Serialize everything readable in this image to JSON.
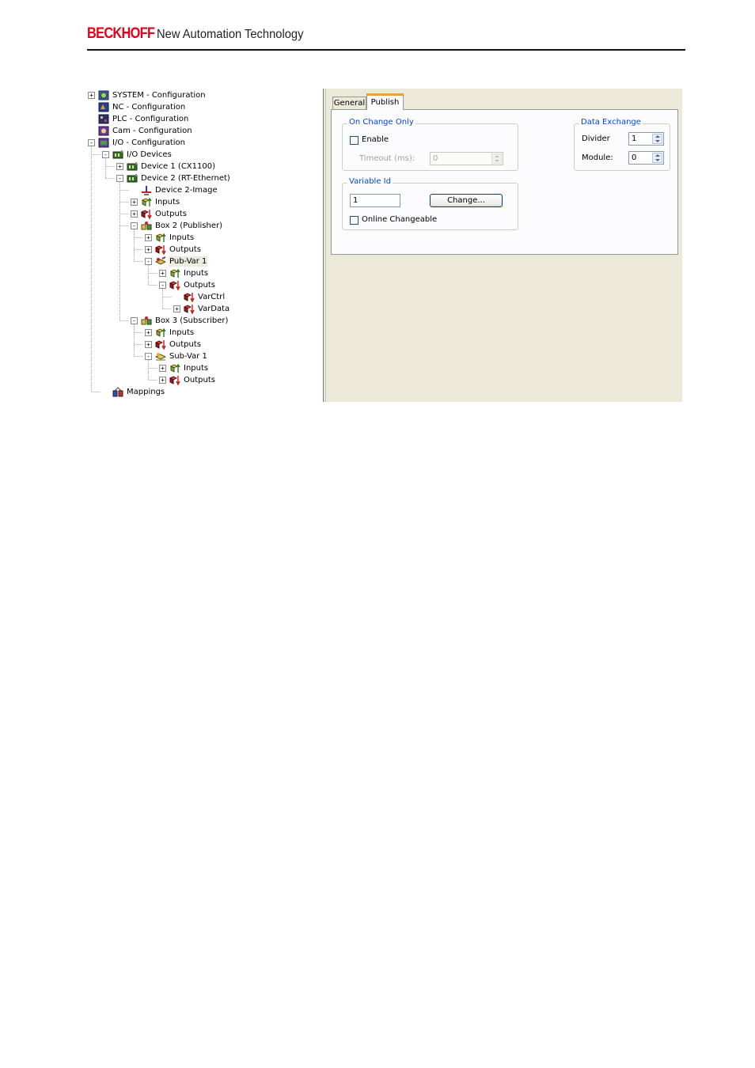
{
  "header": {
    "logo_text": "BECKHOFF",
    "tagline": "New Automation Technology"
  },
  "tree": {
    "items": [
      {
        "label": "SYSTEM - Configuration",
        "expander": "+",
        "icon": "system-config-icon"
      },
      {
        "label": "NC - Configuration",
        "expander": "",
        "icon": "nc-config-icon"
      },
      {
        "label": "PLC - Configuration",
        "expander": "",
        "icon": "plc-config-icon"
      },
      {
        "label": "Cam - Configuration",
        "expander": "",
        "icon": "cam-config-icon"
      },
      {
        "label": "I/O - Configuration",
        "expander": "-",
        "icon": "io-config-icon"
      },
      {
        "label": "I/O Devices",
        "expander": "-",
        "icon": "io-devices-icon"
      },
      {
        "label": "Device 1 (CX1100)",
        "expander": "+",
        "icon": "device-icon"
      },
      {
        "label": "Device 2 (RT-Ethernet)",
        "expander": "-",
        "icon": "device-icon"
      },
      {
        "label": "Device 2-Image",
        "expander": "",
        "icon": "device-image-icon"
      },
      {
        "label": "Inputs",
        "expander": "+",
        "icon": "inputs-icon"
      },
      {
        "label": "Outputs",
        "expander": "+",
        "icon": "outputs-icon"
      },
      {
        "label": "Box 2 (Publisher)",
        "expander": "-",
        "icon": "box-icon"
      },
      {
        "label": "Inputs",
        "expander": "+",
        "icon": "inputs-icon"
      },
      {
        "label": "Outputs",
        "expander": "+",
        "icon": "outputs-icon"
      },
      {
        "label": "Pub-Var 1",
        "expander": "-",
        "icon": "pub-var-icon",
        "selected": true
      },
      {
        "label": "Inputs",
        "expander": "+",
        "icon": "inputs-icon"
      },
      {
        "label": "Outputs",
        "expander": "-",
        "icon": "outputs-icon"
      },
      {
        "label": "VarCtrl",
        "expander": "",
        "icon": "output-var-icon"
      },
      {
        "label": "VarData",
        "expander": "+",
        "icon": "output-var-icon"
      },
      {
        "label": "Box 3 (Subscriber)",
        "expander": "-",
        "icon": "box-icon"
      },
      {
        "label": "Inputs",
        "expander": "+",
        "icon": "inputs-icon"
      },
      {
        "label": "Outputs",
        "expander": "+",
        "icon": "outputs-icon"
      },
      {
        "label": "Sub-Var 1",
        "expander": "-",
        "icon": "sub-var-icon"
      },
      {
        "label": "Inputs",
        "expander": "+",
        "icon": "inputs-icon"
      },
      {
        "label": "Outputs",
        "expander": "+",
        "icon": "outputs-icon"
      },
      {
        "label": "Mappings",
        "expander": "",
        "icon": "mappings-icon"
      }
    ]
  },
  "tabs": {
    "general": "General",
    "publish": "Publish"
  },
  "on_change_only": {
    "legend": "On Change Only",
    "enable_label": "Enable",
    "enable_checked": false,
    "timeout_label": "Timeout (ms):",
    "timeout_value": "0"
  },
  "data_exchange": {
    "legend": "Data Exchange",
    "divider_label": "Divider",
    "divider_value": "1",
    "module_label": "Module:",
    "module_value": "0"
  },
  "variable_id": {
    "legend": "Variable Id",
    "value": "1",
    "change_button": "Change...",
    "online_changeable_label": "Online Changeable",
    "online_changeable_checked": false
  },
  "colors": {
    "brand_red": "#e2001a",
    "legend_blue": "#0046d5",
    "tab_highlight": "#e8a13a",
    "dialog_bg": "#ece9d8"
  }
}
